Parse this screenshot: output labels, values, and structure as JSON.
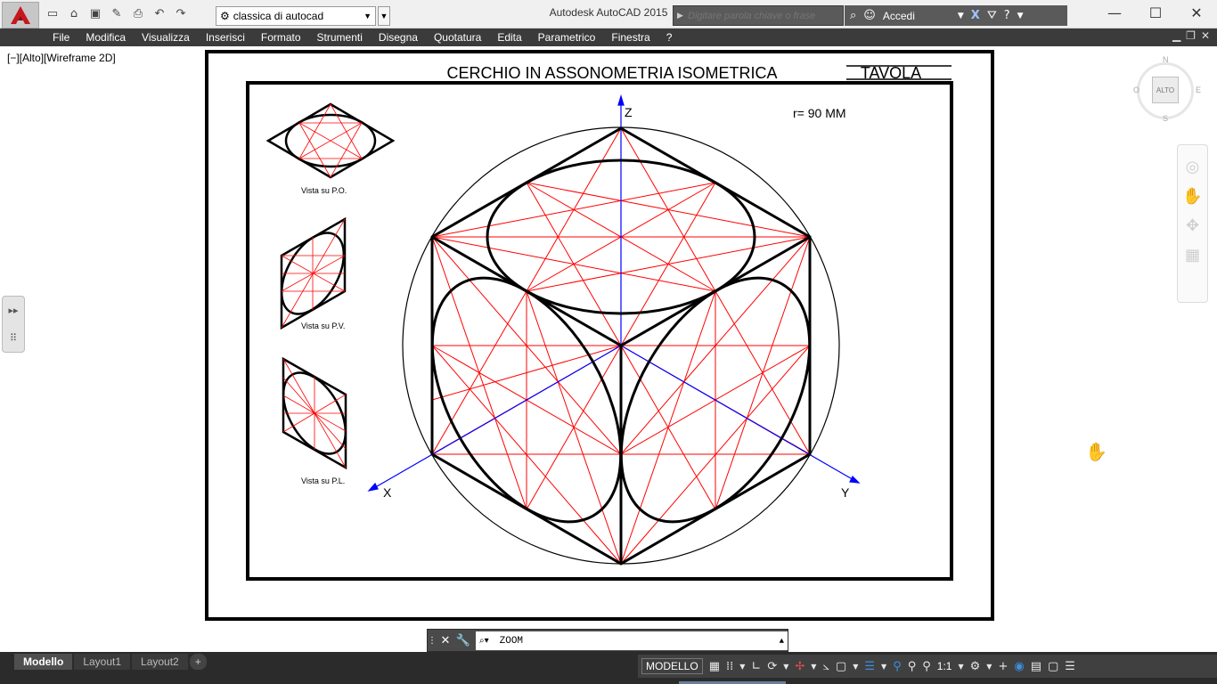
{
  "window": {
    "title": "Autodesk AutoCAD 2015",
    "minimize": "—",
    "maximize": "☐",
    "close": "✕"
  },
  "quick_access": {
    "workspace": "classica di autocad",
    "search_placeholder": "Digitare parola chiave o frase",
    "signin_label": "Accedi"
  },
  "menu": {
    "items": [
      "File",
      "Modifica",
      "Visualizza",
      "Inserisci",
      "Formato",
      "Strumenti",
      "Disegna",
      "Quotatura",
      "Edita",
      "Parametrico",
      "Finestra",
      "?"
    ]
  },
  "viewport": {
    "label": "[−][Alto][Wireframe 2D]"
  },
  "viewcube": {
    "face": "ALTO",
    "north": "N",
    "south": "S",
    "east": "E",
    "west": "O"
  },
  "drawing": {
    "title": "CERCHIO IN ASSONOMETRIA ISOMETRICA",
    "tavola": "TAVOLA",
    "radius": "r= 90 MM",
    "axis_z": "Z",
    "axis_x": "X",
    "axis_y": "Y",
    "view_po": "Vista su P.O.",
    "view_pv": "Vista su P.V.",
    "view_pl": "Vista su P.L."
  },
  "command_line": {
    "value": "ZOOM"
  },
  "layout_tabs": [
    "Modello",
    "Layout1",
    "Layout2"
  ],
  "status": {
    "model": "MODELLO",
    "scale": "1:1"
  },
  "colors": {
    "construction_red": "#ff0000",
    "axis_blue": "#0000ff",
    "menu_bg": "#3b3b3b",
    "status_bg": "#2b2b2b"
  }
}
